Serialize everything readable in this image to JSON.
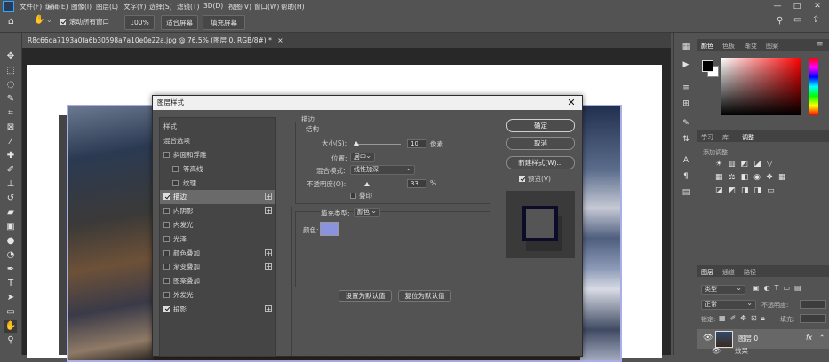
{
  "menu": {
    "items": [
      "文件(F)",
      "编辑(E)",
      "图像(I)",
      "图层(L)",
      "文字(Y)",
      "选择(S)",
      "滤镜(T)",
      "3D(D)",
      "视图(V)",
      "窗口(W)",
      "帮助(H)"
    ],
    "window_controls": [
      "—",
      "□",
      "✕"
    ]
  },
  "options_bar": {
    "scroll_all_label": "滚动所有窗口",
    "scroll_all_checked": true,
    "zoom_button": "100%",
    "fit_screen_button": "适合屏幕",
    "fill_screen_button": "填充屏幕"
  },
  "document_tab": {
    "title": "R8c66da7193a0fa6b30598a7a10e0e22a.jpg @ 76.5% (图层 0, RGB/8#) *",
    "close": "×"
  },
  "dialog": {
    "title": "图层样式",
    "close": "✕",
    "styles_header": "样式",
    "blend_options": "混合选项",
    "styles": [
      {
        "label": "斜面和浮雕",
        "checked": false,
        "plus": false,
        "indent": false
      },
      {
        "label": "等高线",
        "checked": false,
        "plus": false,
        "indent": true
      },
      {
        "label": "纹理",
        "checked": false,
        "plus": false,
        "indent": true
      },
      {
        "label": "描边",
        "checked": true,
        "plus": true,
        "indent": false
      },
      {
        "label": "内阴影",
        "checked": false,
        "plus": true,
        "indent": false
      },
      {
        "label": "内发光",
        "checked": false,
        "plus": false,
        "indent": false
      },
      {
        "label": "光泽",
        "checked": false,
        "plus": false,
        "indent": false
      },
      {
        "label": "颜色叠加",
        "checked": false,
        "plus": true,
        "indent": false
      },
      {
        "label": "渐变叠加",
        "checked": false,
        "plus": true,
        "indent": false
      },
      {
        "label": "图案叠加",
        "checked": false,
        "plus": false,
        "indent": false
      },
      {
        "label": "外发光",
        "checked": false,
        "plus": false,
        "indent": false
      },
      {
        "label": "投影",
        "checked": true,
        "plus": true,
        "indent": false
      }
    ],
    "stroke": {
      "section_title": "描边",
      "structure_title": "结构",
      "size_label": "大小(S):",
      "size_value": "10",
      "size_unit": "像素",
      "position_label": "位置:",
      "position_value": "居中",
      "blend_label": "混合模式:",
      "blend_value": "线性加深",
      "opacity_label": "不透明度(O):",
      "opacity_value": "33",
      "opacity_unit": "%",
      "overprint_label": "叠印",
      "fill_type_label": "填充类型:",
      "fill_type_value": "颜色",
      "color_label": "颜色:",
      "color": "#8b93e0",
      "size_slider_fraction": 0.05,
      "opacity_slider_fraction": 0.33
    },
    "set_default_button": "设置为默认值",
    "reset_default_button": "复位为默认值",
    "ok_button": "确定",
    "cancel_button": "取消",
    "new_style_button": "新建样式(W)...",
    "preview_label": "预览(V)",
    "preview_checked": true
  },
  "panels": {
    "color_tabs": [
      "颜色",
      "色板",
      "渐变",
      "图案"
    ],
    "adjust_tabs": [
      "学习",
      "库",
      "调整"
    ],
    "add_adjustment": "添加调整",
    "layers_tabs": [
      "图层",
      "通道",
      "路径"
    ],
    "kind_filter": "类型",
    "blend_mode": "正常",
    "opacity_label": "不透明度:",
    "lock_label": "锁定:",
    "fill_label": "填充:",
    "layer_name": "图层 0",
    "fx_label": "fx",
    "effects_label": "效果"
  }
}
